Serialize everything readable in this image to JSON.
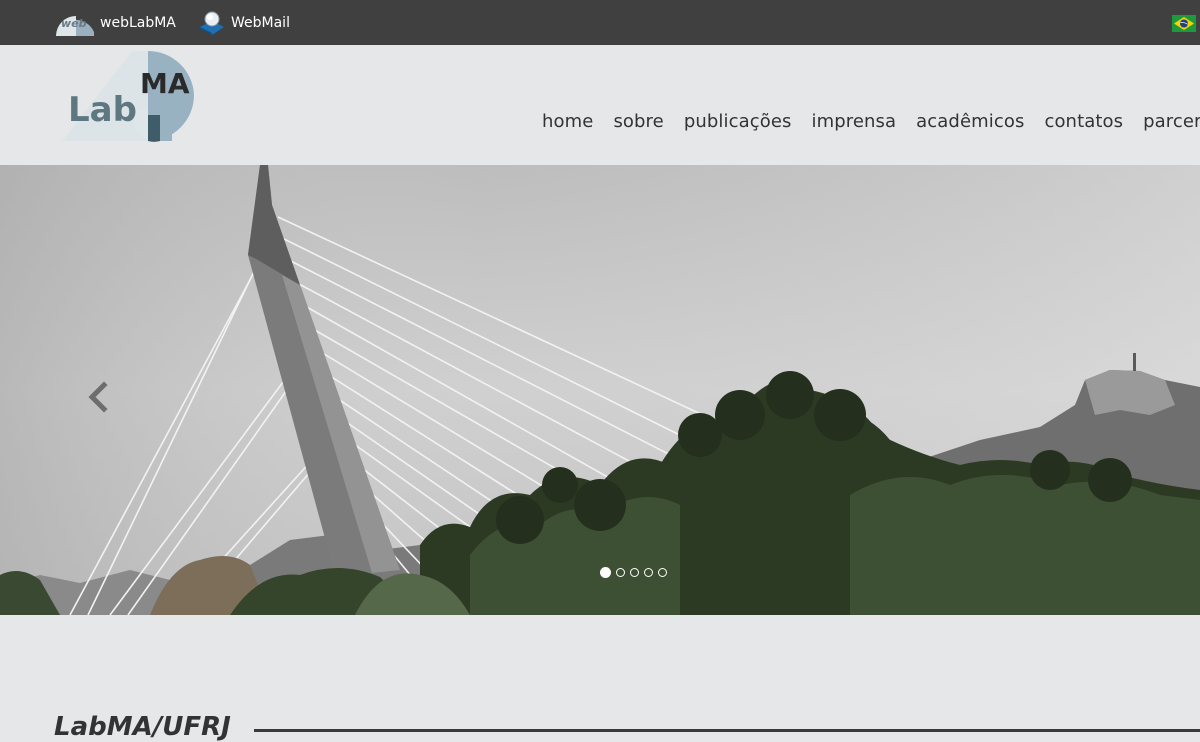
{
  "topbar": {
    "weblab_label": "webLabMA",
    "weblab_icon_text": "web",
    "webmail_label": "WebMail",
    "flag_icon": "brazil-flag-icon"
  },
  "header": {
    "logo_text_lab": "Lab",
    "logo_text_ma": "MA"
  },
  "nav": {
    "items": [
      "home",
      "sobre",
      "publicações",
      "imprensa",
      "acadêmicos",
      "contatos",
      "parcerias"
    ]
  },
  "carousel": {
    "slide_count": 5,
    "active_index": 0,
    "prev_icon": "chevron-left-icon"
  },
  "section": {
    "title": "LabMA/UFRJ"
  },
  "colors": {
    "topbar_bg": "#404040",
    "page_bg": "#e6e7e9",
    "logo_blue": "#8fa9b9",
    "logo_dark": "#3d5a66"
  }
}
